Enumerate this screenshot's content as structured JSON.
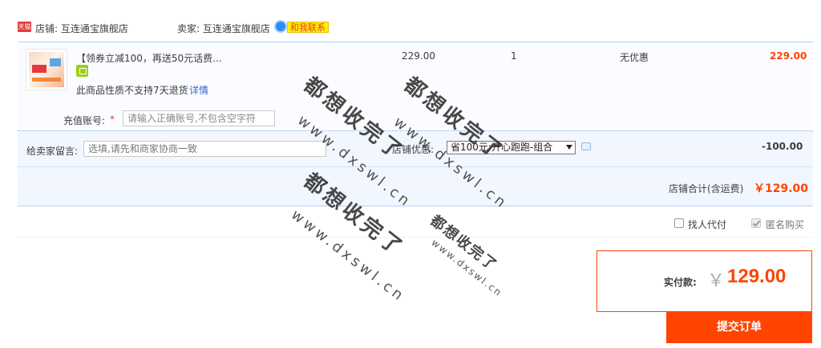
{
  "shop": {
    "badge": "天猫",
    "shop_label": "店铺: 互连通宝旗舰店",
    "seller_label": "卖家: 互连通宝旗舰店",
    "contact_label": "和我联系"
  },
  "item": {
    "title": "【领券立减100，再送50元话费...",
    "no_return_text": "此商品性质不支持7天退货",
    "detail_link": "详情",
    "price": "229.00",
    "quantity": "1",
    "promotion": "无优惠",
    "subtotal": "229.00"
  },
  "recharge": {
    "label": "充值账号:",
    "required_mark": "*",
    "placeholder": "请输入正确账号,不包含空字符"
  },
  "message": {
    "label": "给卖家留言:",
    "placeholder": "选填,请先和商家协商一致"
  },
  "discount": {
    "label": "店铺优惠:",
    "selected": "省100元:开心跑跑-组合",
    "amount": "-100.00"
  },
  "shop_total": {
    "label": "店铺合计(含运费)",
    "amount": "￥129.00"
  },
  "options": {
    "pay_for_me_label": "找人代付",
    "pay_for_me_checked": false,
    "anonymous_label": "匿名购买",
    "anonymous_checked": true
  },
  "payment": {
    "label": "实付款:",
    "currency": "￥",
    "amount": "129.00",
    "submit_label": "提交订单"
  },
  "watermark": {
    "text": "都想收完了",
    "url": "www.dxswl.cn"
  },
  "colors": {
    "accent": "#ff4400",
    "link": "#3366cc",
    "row_bg": "#f2f7ff"
  }
}
